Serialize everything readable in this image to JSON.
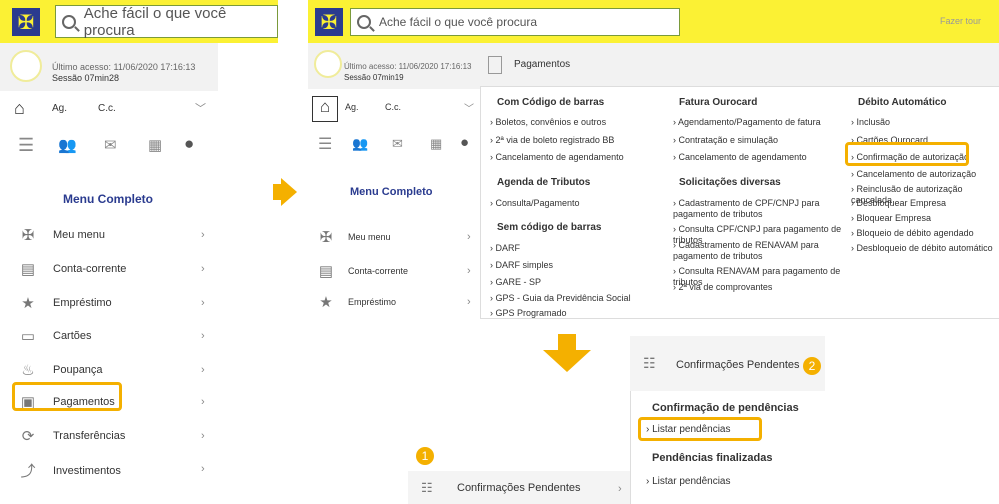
{
  "search": {
    "placeholder": "Ache fácil o que você procura"
  },
  "header2": {
    "fazer_tour": "Fazer tour"
  },
  "session1": {
    "last_access": "Último acesso: 11/06/2020 17:16:13",
    "session": "Sessão 07min28"
  },
  "session2": {
    "last_access": "Último acesso: 11/06/2020 17:16:13",
    "session": "Sessão 07min19"
  },
  "account": {
    "ag": "Ag.",
    "cc": "C.c."
  },
  "menu_title": "Menu Completo",
  "menu": [
    "Meu menu",
    "Conta-corrente",
    "Empréstimo",
    "Cartões",
    "Poupança",
    "Pagamentos",
    "Transferências",
    "Investimentos"
  ],
  "payments": {
    "title": "Pagamentos",
    "col1": {
      "h1": "Com Código de barras",
      "l1": [
        "Boletos, convênios e outros",
        "2ª via de boleto registrado BB",
        "Cancelamento de agendamento"
      ],
      "h2": "Agenda de Tributos",
      "l2": [
        "Consulta/Pagamento"
      ],
      "h3": "Sem código de barras",
      "l3": [
        "DARF",
        "DARF simples",
        "GARE - SP",
        "GPS - Guia da Previdência Social",
        "GPS Programado"
      ]
    },
    "col2": {
      "h1": "Fatura Ourocard",
      "l1": [
        "Agendamento/Pagamento de fatura",
        "Contratação e simulação",
        "Cancelamento de agendamento"
      ],
      "h2": "Solicitações diversas",
      "l2": [
        "Cadastramento de CPF/CNPJ para pagamento de tributos",
        "Consulta CPF/CNPJ para pagamento de tributos",
        "Cadastramento de RENAVAM para pagamento de tributos",
        "Consulta RENAVAM para pagamento de tributos",
        "2ª via de comprovantes"
      ]
    },
    "col3": {
      "h1": "Débito Automático",
      "l1": [
        "Inclusão",
        "Cartões Ourocard",
        "Confirmação de autorização",
        "Cancelamento de autorização",
        "Reinclusão de autorização cancelada",
        "Desbloquear Empresa",
        "Bloquear Empresa",
        "Bloqueio de débito agendado",
        "Desbloqueio de débito automático"
      ]
    }
  },
  "confirm_menu": {
    "label": "Confirmações Pendentes",
    "badge1": "1",
    "badge2": "2"
  },
  "pend": {
    "h1": "Confirmação de pendências",
    "l1": "Listar pendências",
    "h2": "Pendências finalizadas",
    "l2": "Listar pendências"
  },
  "colors": {
    "yellow": "#fbf134",
    "blue": "#2a3b8f",
    "highlight": "#f4b000"
  }
}
